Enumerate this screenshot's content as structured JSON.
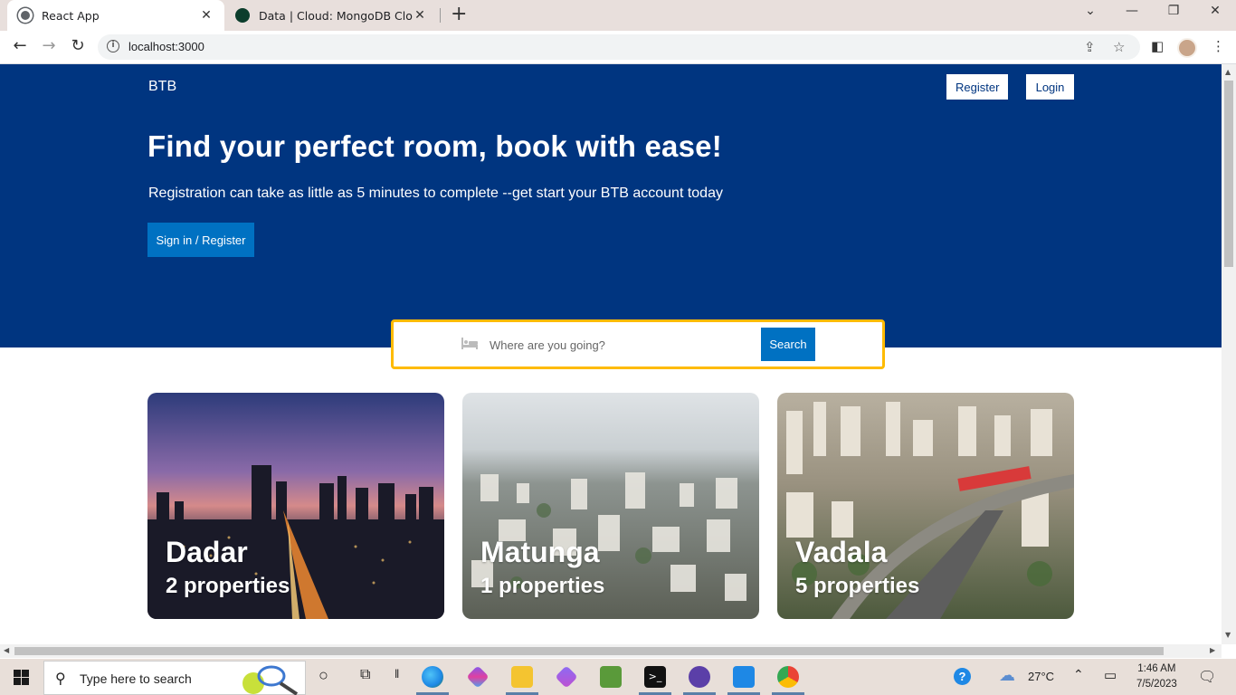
{
  "browser": {
    "tabs": [
      {
        "title": "React App",
        "active": true
      },
      {
        "title": "Data | Cloud: MongoDB Cloud",
        "active": false
      }
    ],
    "url": "localhost:3000"
  },
  "page": {
    "brand": "BTB",
    "nav": {
      "register": "Register",
      "login": "Login"
    },
    "hero_title": "Find your perfect room, book with ease!",
    "hero_subtitle": "Registration can take as little as 5 minutes to complete --get start your BTB account today",
    "cta": "Sign in / Register",
    "search": {
      "placeholder": "Where are you going?",
      "button": "Search"
    },
    "cities": [
      {
        "name": "Dadar",
        "count": "2 properties"
      },
      {
        "name": "Matunga",
        "count": "1 properties"
      },
      {
        "name": "Vadala",
        "count": "5 properties"
      }
    ],
    "colors": {
      "brand_blue": "#003580",
      "button_blue": "#0071c2",
      "search_border": "#febb02"
    }
  },
  "taskbar": {
    "search_text": "Type here to search",
    "weather": "27°C",
    "time": "1:46 AM",
    "date": "7/5/2023"
  }
}
